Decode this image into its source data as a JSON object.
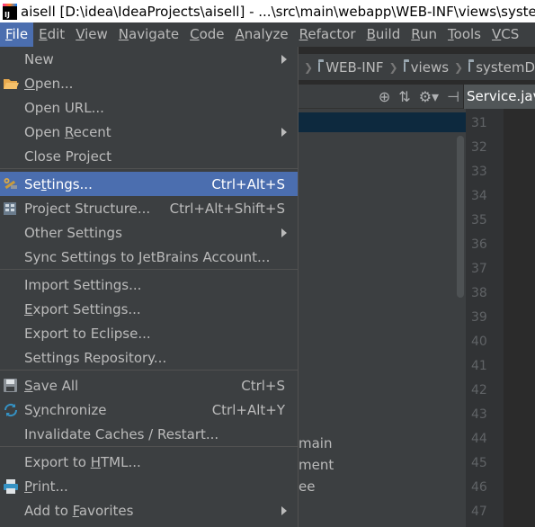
{
  "window": {
    "title": "aisell [D:\\idea\\IdeaProjects\\aisell] - ...\\src\\main\\webapp\\WEB-INF\\views\\systemD"
  },
  "menubar": {
    "items": [
      {
        "label": "File",
        "active": true
      },
      {
        "label": "Edit"
      },
      {
        "label": "View"
      },
      {
        "label": "Navigate"
      },
      {
        "label": "Code"
      },
      {
        "label": "Analyze"
      },
      {
        "label": "Refactor"
      },
      {
        "label": "Build"
      },
      {
        "label": "Run"
      },
      {
        "label": "Tools"
      },
      {
        "label": "VCS"
      }
    ]
  },
  "breadcrumb": {
    "items": [
      "WEB-INF",
      "views",
      "systemD"
    ]
  },
  "editor": {
    "tab_label": "Service.java",
    "line_numbers": [
      "31",
      "32",
      "33",
      "34",
      "35",
      "36",
      "37",
      "38",
      "39",
      "40",
      "41",
      "42",
      "43",
      "44",
      "45",
      "46",
      "47"
    ]
  },
  "project_tree": {
    "visible_fragments": [
      "main",
      "ment",
      "ee"
    ]
  },
  "file_menu": {
    "items": [
      {
        "label": "New",
        "shortcut": "",
        "submenu": true,
        "icon": ""
      },
      {
        "label": "Open...",
        "shortcut": "",
        "submenu": false,
        "icon": "open-folder-icon"
      },
      {
        "label": "Open URL...",
        "shortcut": "",
        "submenu": false,
        "icon": ""
      },
      {
        "label": "Open Recent",
        "shortcut": "",
        "submenu": true,
        "icon": ""
      },
      {
        "label": "Close Project",
        "shortcut": "",
        "submenu": false,
        "icon": ""
      },
      {
        "label": "Settings...",
        "shortcut": "Ctrl+Alt+S",
        "submenu": false,
        "icon": "wrench-icon",
        "selected": true
      },
      {
        "label": "Project Structure...",
        "shortcut": "Ctrl+Alt+Shift+S",
        "submenu": false,
        "icon": "project-structure-icon"
      },
      {
        "label": "Other Settings",
        "shortcut": "",
        "submenu": true,
        "icon": ""
      },
      {
        "label": "Sync Settings to JetBrains Account...",
        "shortcut": "",
        "submenu": false,
        "icon": ""
      },
      {
        "label": "Import Settings...",
        "shortcut": "",
        "submenu": false,
        "icon": ""
      },
      {
        "label": "Export Settings...",
        "shortcut": "",
        "submenu": false,
        "icon": ""
      },
      {
        "label": "Export to Eclipse...",
        "shortcut": "",
        "submenu": false,
        "icon": ""
      },
      {
        "label": "Settings Repository...",
        "shortcut": "",
        "submenu": false,
        "icon": ""
      },
      {
        "label": "Save All",
        "shortcut": "Ctrl+S",
        "submenu": false,
        "icon": "save-icon"
      },
      {
        "label": "Synchronize",
        "shortcut": "Ctrl+Alt+Y",
        "submenu": false,
        "icon": "sync-icon"
      },
      {
        "label": "Invalidate Caches / Restart...",
        "shortcut": "",
        "submenu": false,
        "icon": ""
      },
      {
        "label": "Export to HTML...",
        "shortcut": "",
        "submenu": false,
        "icon": ""
      },
      {
        "label": "Print...",
        "shortcut": "",
        "submenu": false,
        "icon": "printer-icon"
      },
      {
        "label": "Add to Favorites",
        "shortcut": "",
        "submenu": true,
        "icon": ""
      }
    ]
  },
  "colors": {
    "menu_bg": "#3c3f41",
    "selection": "#4b6eaf",
    "editor_bg": "#2b2b2b",
    "gutter_bg": "#313335",
    "text": "#bbbbbb"
  }
}
